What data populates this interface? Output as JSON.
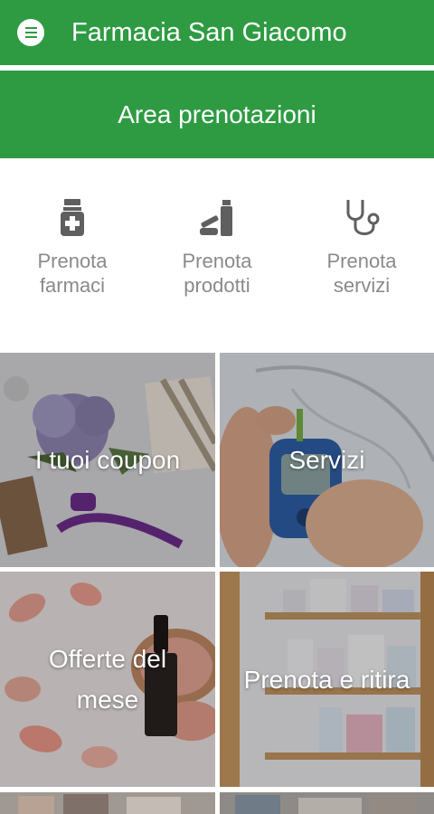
{
  "app": {
    "title": "Farmacia San Giacomo",
    "menu_icon": "menu-icon"
  },
  "banner": {
    "label": "Area prenotazioni"
  },
  "quick_actions": [
    {
      "label": "Prenota farmaci",
      "icon": "medicine-bottle-icon"
    },
    {
      "label": "Prenota prodotti",
      "icon": "cosmetic-products-icon"
    },
    {
      "label": "Prenota servizi",
      "icon": "stethoscope-icon"
    }
  ],
  "tiles": [
    {
      "label": "I tuoi coupon"
    },
    {
      "label": "Servizi"
    },
    {
      "label": "Offerte del mese"
    },
    {
      "label": "Prenota e ritira"
    }
  ],
  "colors": {
    "primary": "#2e9b43",
    "icon": "#5f5f5f",
    "label": "#8a8a8a"
  }
}
